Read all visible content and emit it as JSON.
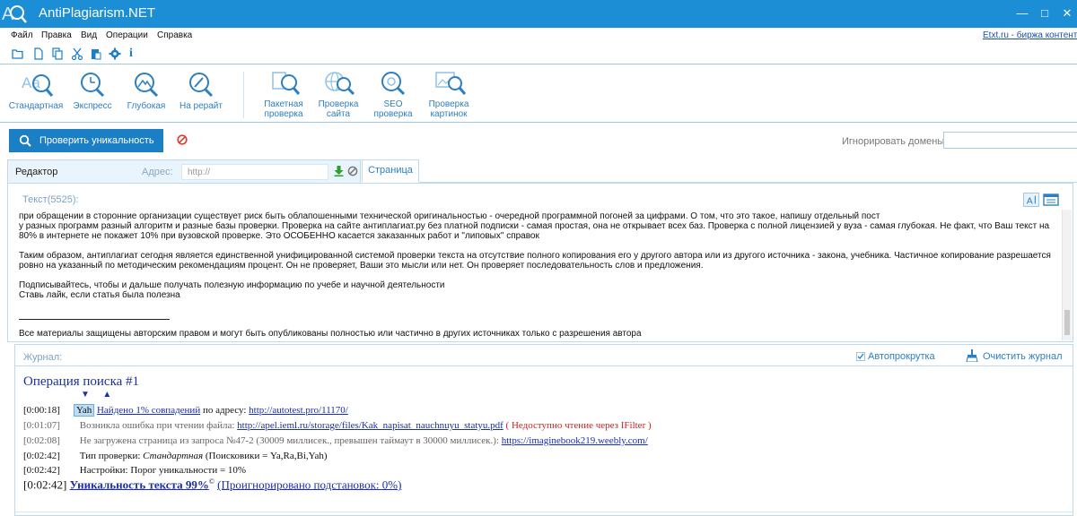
{
  "window": {
    "title": "AntiPlagiarism.NET",
    "controls": {
      "minimize": "—",
      "maximize": "□",
      "close": "✕"
    }
  },
  "menu": {
    "items": [
      "Файл",
      "Правка",
      "Вид",
      "Операции",
      "Справка"
    ],
    "etxt_link": "Etxt.ru - биржа контента"
  },
  "quick_toolbar": {
    "icons": [
      "open-folder-icon",
      "new-document-icon",
      "copy-icon",
      "cut-icon",
      "paste-icon",
      "settings-icon",
      "info-icon"
    ],
    "info_glyph": "i"
  },
  "ribbon": {
    "check_types": [
      {
        "label": "Стандартная",
        "icon": "standard-check-icon"
      },
      {
        "label": "Экспресс",
        "icon": "express-check-icon"
      },
      {
        "label": "Глубокая",
        "icon": "deep-check-icon"
      },
      {
        "label": "На рерайт",
        "icon": "rewrite-check-icon"
      }
    ],
    "tools": [
      {
        "line1": "Пакетная",
        "line2": "проверка",
        "icon": "batch-check-icon"
      },
      {
        "line1": "Проверка",
        "line2": "сайта",
        "icon": "site-check-icon"
      },
      {
        "line1": "SEO",
        "line2": "проверка",
        "icon": "seo-check-icon"
      },
      {
        "line1": "Проверка",
        "line2": "картинок",
        "icon": "image-check-icon"
      }
    ]
  },
  "actions": {
    "check_button": "Проверить уникальность",
    "ignore_domains_label": "Игнорировать домены:",
    "ignore_domains_value": ""
  },
  "tabs": {
    "editor": "Редактор",
    "address_label": "Адрес:",
    "address_placeholder": "http://",
    "page": "Страница"
  },
  "editor": {
    "label": "Текст(5525):",
    "lines": [
      "при обращении в сторонние организации существует риск быть облапошенными технической оригинальностью - очередной программной погоней за цифрами. О том, что это такое, напишу отдельный пост",
      "у разных программ разный алгоритм и разные базы проверки. Проверка на сайте антиплагиат.ру без платной подписки - самая простая, она не открывает всех баз. Проверка с полной лицензией у вуза - самая глубокая. Не факт, что Ваш текст на 80% в интернете не покажет 10% при вузовской проверке. Это ОСОБЕННО касается заказанных работ и \"липовых\" справок",
      "Таким образом, антиплагиат сегодня является единственной унифицированной системой проверки текста на отсутствие полного копирования его у другого автора или из другого источника - закона, учебника. Частичное копирование разрешается ровно на указанный по методическим рекомендациям процент. Он не проверяет, Ваши это мысли или нет. Он проверяет последовательность слов и предложения.",
      "Подписывайтесь, чтобы и дальше получать полезную информацию по учебе и научной деятельности",
      "Ставь лайк, если статья была полезна",
      "Все материалы защищены авторским правом и могут быть опубликованы полностью или частично в других источниках только с разрешения автора"
    ]
  },
  "journal": {
    "label": "Журнал:",
    "autoscroll_label": "Автопрокрутка",
    "autoscroll_checked": true,
    "clear_label": "Очистить журнал",
    "operation_title": "Операция поиска #1",
    "arrows": "▼ ▲",
    "entries": [
      {
        "time": "[0:00:18]",
        "engine": "Yah",
        "text": "Найдено 1% совпадений",
        "after": " по адресу: ",
        "link": "http://autotest.pro/11170/"
      },
      {
        "time": "[0:01:07]",
        "text": "Возникла ошибка при чтении файла: ",
        "link": "http://apel.ieml.ru/storage/files/Kak_napisat_nauchnuyu_statyu.pdf",
        "error": " ( Недоступно чтение через IFilter )"
      },
      {
        "time": "[0:02:08]",
        "text": "Не загружена страница из запроса №47-2 (30009 миллисек., превышен таймаут в 30000 миллисек.): ",
        "link": "https://imaginebook219.weebly.com/"
      },
      {
        "time": "[0:02:42]",
        "text": "Тип проверки: ",
        "italic": "Стандартная",
        "after": " (Поисковики = Ya,Ra,Bi,Yah)"
      },
      {
        "time": "[0:02:42]",
        "text": "Настройки: Порог уникальности = 10%"
      }
    ],
    "final": {
      "time": "[0:02:42]",
      "uniqueness": "Уникальность текста 99%",
      "copyright": "©",
      "ignored": "(Проигнорировано подстановок: 0%)"
    }
  }
}
